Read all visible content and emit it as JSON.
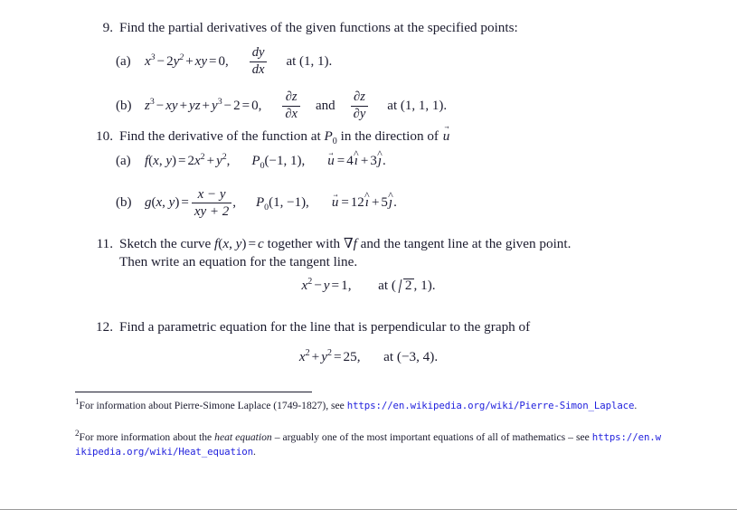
{
  "document": {
    "type": "mathematics-exercise-sheet",
    "link_color": "#2222dd",
    "text_color": "#1b1b2e"
  },
  "problems": [
    {
      "number": "9.",
      "stem": "Find the partial derivatives of the given functions at the specified points:",
      "items": [
        {
          "label": "(a)",
          "equation": "x³ − 2y² + xy = 0,",
          "derivative_num": "dy",
          "derivative_den": "dx",
          "at": "at (1, 1)."
        },
        {
          "label": "(b)",
          "equation": "z³ − xy + yz + y³ − 2 = 0,",
          "derivative_num": "∂z",
          "derivative_den": "∂x",
          "conjunction": "and",
          "derivative2_num": "∂z",
          "derivative2_den": "∂y",
          "at": "at (1, 1, 1)."
        }
      ]
    },
    {
      "number": "10.",
      "stem": "Find the derivative of the function at P₀ in the direction of u⃗",
      "items": [
        {
          "label": "(a)",
          "function": "f(x, y) = 2x² + y²,",
          "point": "P₀(−1, 1),",
          "direction": "u⃗ = 4î + 3ĵ."
        },
        {
          "label": "(b)",
          "function_lhs": "g(x, y) =",
          "function_num": "x − y",
          "function_den": "xy + 2",
          "function_tail": ",",
          "point": "P₀(1, −1),",
          "direction": "u⃗ = 12î + 5ĵ."
        }
      ]
    },
    {
      "number": "11.",
      "stem_line1": "Sketch the curve f(x, y) = c together with ∇f and the tangent line at the given point.",
      "stem_line2": "Then write an equation for the tangent line.",
      "display": "x² − y = 1,    at (√2, 1)."
    },
    {
      "number": "12.",
      "stem": "Find a parametric equation for the line that is perpendicular to the graph of",
      "display": "x² + y² = 25,    at (−3, 4)."
    }
  ],
  "footnotes": [
    {
      "mark": "1",
      "text_before": "For information about Pierre-Simone Laplace (1749-1827), see ",
      "url": "https://en.wikipedia.org/wiki/Pierre-Simon_Laplace",
      "text_after": "."
    },
    {
      "mark": "2",
      "text_before_1": "For more information about the ",
      "italic_phrase": "heat equation",
      "text_before_2": " – arguably one of the most important equations of all of mathematics – see ",
      "url": "https://en.wikipedia.org/wiki/Heat_equation",
      "text_after": "."
    }
  ]
}
